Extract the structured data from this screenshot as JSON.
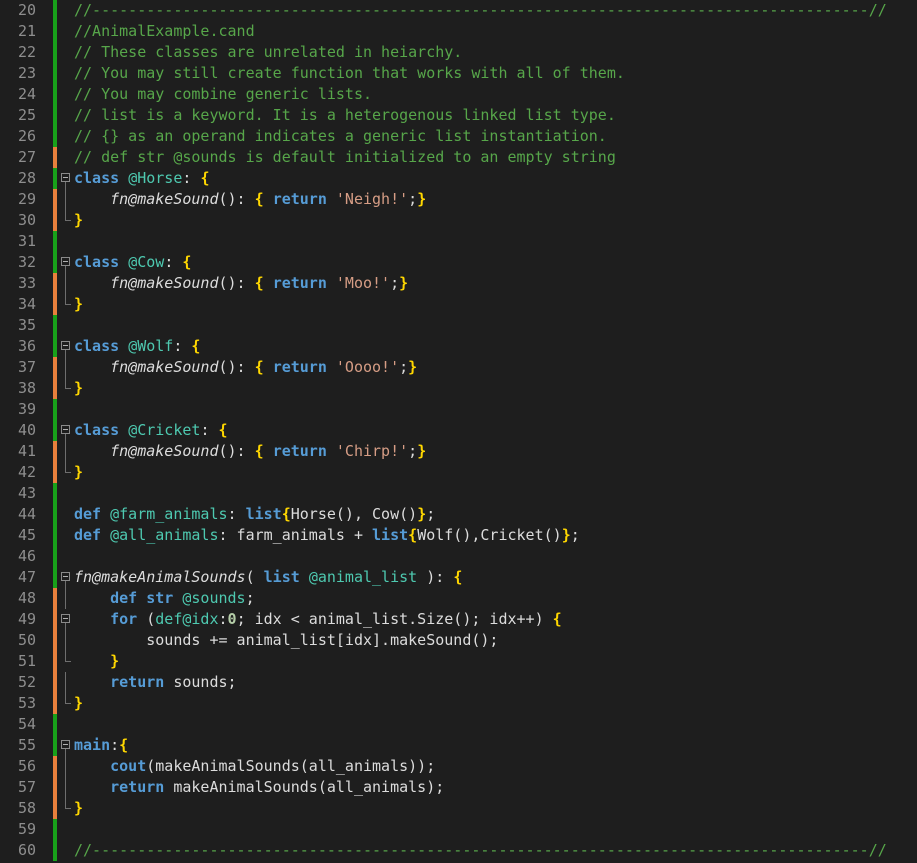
{
  "editor": {
    "colors": {
      "background": "#1e1e1e",
      "line_number": "#8e8e8e",
      "saved_change": "#18a11a",
      "unsaved_change": "#e8803c",
      "comment": "#57a64a",
      "keyword": "#569cd6",
      "identifier": "#4ec9b0",
      "string": "#d69d85",
      "brace": "#ffd700"
    },
    "lines": [
      {
        "n": "20",
        "change": "saved",
        "fold": "none",
        "tokens": [
          [
            "comment",
            "//--------------------------------------------------------------------------------------//"
          ]
        ]
      },
      {
        "n": "21",
        "change": "saved",
        "fold": "none",
        "tokens": [
          [
            "comment",
            "//AnimalExample.cand"
          ]
        ]
      },
      {
        "n": "22",
        "change": "saved",
        "fold": "none",
        "tokens": [
          [
            "comment",
            "// These classes are unrelated in heiarchy."
          ]
        ]
      },
      {
        "n": "23",
        "change": "saved",
        "fold": "none",
        "tokens": [
          [
            "comment",
            "// You may still create function that works with all of them."
          ]
        ]
      },
      {
        "n": "24",
        "change": "saved",
        "fold": "none",
        "tokens": [
          [
            "comment",
            "// You may combine generic lists."
          ]
        ]
      },
      {
        "n": "25",
        "change": "saved",
        "fold": "none",
        "tokens": [
          [
            "comment",
            "// list is a keyword. It is a heterogenous linked list type."
          ]
        ]
      },
      {
        "n": "26",
        "change": "saved",
        "fold": "none",
        "tokens": [
          [
            "comment",
            "// {} as an operand indicates a generic list instantiation."
          ]
        ]
      },
      {
        "n": "27",
        "change": "unsaved",
        "fold": "none",
        "tokens": [
          [
            "comment",
            "// def str @sounds is default initialized to an empty string"
          ]
        ]
      },
      {
        "n": "28",
        "change": "saved",
        "fold": "start",
        "tokens": [
          [
            "kw",
            "class"
          ],
          [
            "p",
            " "
          ],
          [
            "name",
            "@Horse"
          ],
          [
            "p",
            ": "
          ],
          [
            "brace",
            "{"
          ]
        ]
      },
      {
        "n": "29",
        "change": "unsaved",
        "fold": "mid",
        "tokens": [
          [
            "p",
            "    "
          ],
          [
            "fn",
            "fn@makeSound"
          ],
          [
            "p",
            "(): "
          ],
          [
            "brace",
            "{"
          ],
          [
            "p",
            " "
          ],
          [
            "kw",
            "return"
          ],
          [
            "p",
            " "
          ],
          [
            "str",
            "'Neigh!'"
          ],
          [
            "p",
            ";"
          ],
          [
            "brace",
            "}"
          ]
        ]
      },
      {
        "n": "30",
        "change": "unsaved",
        "fold": "end",
        "tokens": [
          [
            "brace",
            "}"
          ]
        ]
      },
      {
        "n": "31",
        "change": "saved",
        "fold": "none",
        "tokens": []
      },
      {
        "n": "32",
        "change": "saved",
        "fold": "start",
        "tokens": [
          [
            "kw",
            "class"
          ],
          [
            "p",
            " "
          ],
          [
            "name",
            "@Cow"
          ],
          [
            "p",
            ": "
          ],
          [
            "brace",
            "{"
          ]
        ]
      },
      {
        "n": "33",
        "change": "unsaved",
        "fold": "mid",
        "tokens": [
          [
            "p",
            "    "
          ],
          [
            "fn",
            "fn@makeSound"
          ],
          [
            "p",
            "(): "
          ],
          [
            "brace",
            "{"
          ],
          [
            "p",
            " "
          ],
          [
            "kw",
            "return"
          ],
          [
            "p",
            " "
          ],
          [
            "str",
            "'Moo!'"
          ],
          [
            "p",
            ";"
          ],
          [
            "brace",
            "}"
          ]
        ]
      },
      {
        "n": "34",
        "change": "unsaved",
        "fold": "end",
        "tokens": [
          [
            "brace",
            "}"
          ]
        ]
      },
      {
        "n": "35",
        "change": "saved",
        "fold": "none",
        "tokens": []
      },
      {
        "n": "36",
        "change": "saved",
        "fold": "start",
        "tokens": [
          [
            "kw",
            "class"
          ],
          [
            "p",
            " "
          ],
          [
            "name",
            "@Wolf"
          ],
          [
            "p",
            ": "
          ],
          [
            "brace",
            "{"
          ]
        ]
      },
      {
        "n": "37",
        "change": "unsaved",
        "fold": "mid",
        "tokens": [
          [
            "p",
            "    "
          ],
          [
            "fn",
            "fn@makeSound"
          ],
          [
            "p",
            "(): "
          ],
          [
            "brace",
            "{"
          ],
          [
            "p",
            " "
          ],
          [
            "kw",
            "return"
          ],
          [
            "p",
            " "
          ],
          [
            "str",
            "'Oooo!'"
          ],
          [
            "p",
            ";"
          ],
          [
            "brace",
            "}"
          ]
        ]
      },
      {
        "n": "38",
        "change": "unsaved",
        "fold": "end",
        "tokens": [
          [
            "brace",
            "}"
          ]
        ]
      },
      {
        "n": "39",
        "change": "saved",
        "fold": "none",
        "tokens": []
      },
      {
        "n": "40",
        "change": "saved",
        "fold": "start",
        "tokens": [
          [
            "kw",
            "class"
          ],
          [
            "p",
            " "
          ],
          [
            "name",
            "@Cricket"
          ],
          [
            "p",
            ": "
          ],
          [
            "brace",
            "{"
          ]
        ]
      },
      {
        "n": "41",
        "change": "unsaved",
        "fold": "mid",
        "tokens": [
          [
            "p",
            "    "
          ],
          [
            "fn",
            "fn@makeSound"
          ],
          [
            "p",
            "(): "
          ],
          [
            "brace",
            "{"
          ],
          [
            "p",
            " "
          ],
          [
            "kw",
            "return"
          ],
          [
            "p",
            " "
          ],
          [
            "str",
            "'Chirp!'"
          ],
          [
            "p",
            ";"
          ],
          [
            "brace",
            "}"
          ]
        ]
      },
      {
        "n": "42",
        "change": "unsaved",
        "fold": "end",
        "tokens": [
          [
            "brace",
            "}"
          ]
        ]
      },
      {
        "n": "43",
        "change": "saved",
        "fold": "none",
        "tokens": []
      },
      {
        "n": "44",
        "change": "saved",
        "fold": "none",
        "tokens": [
          [
            "kw",
            "def"
          ],
          [
            "p",
            " "
          ],
          [
            "name",
            "@farm_animals"
          ],
          [
            "p",
            ": "
          ],
          [
            "kw",
            "list"
          ],
          [
            "brace",
            "{"
          ],
          [
            "p",
            "Horse(), Cow()"
          ],
          [
            "brace",
            "}"
          ],
          [
            "p",
            ";"
          ]
        ]
      },
      {
        "n": "45",
        "change": "saved",
        "fold": "none",
        "tokens": [
          [
            "kw",
            "def"
          ],
          [
            "p",
            " "
          ],
          [
            "name",
            "@all_animals"
          ],
          [
            "p",
            ": farm_animals + "
          ],
          [
            "kw",
            "list"
          ],
          [
            "brace",
            "{"
          ],
          [
            "p",
            "Wolf(),Cricket()"
          ],
          [
            "brace",
            "}"
          ],
          [
            "p",
            ";"
          ]
        ]
      },
      {
        "n": "46",
        "change": "saved",
        "fold": "none",
        "tokens": []
      },
      {
        "n": "47",
        "change": "saved",
        "fold": "start",
        "tokens": [
          [
            "fn",
            "fn@makeAnimalSounds"
          ],
          [
            "p",
            "( "
          ],
          [
            "kw",
            "list"
          ],
          [
            "p",
            " "
          ],
          [
            "name",
            "@animal_list"
          ],
          [
            "p",
            " ): "
          ],
          [
            "brace",
            "{"
          ]
        ]
      },
      {
        "n": "48",
        "change": "unsaved",
        "fold": "mid",
        "tokens": [
          [
            "p",
            "    "
          ],
          [
            "kw",
            "def"
          ],
          [
            "p",
            " "
          ],
          [
            "kw",
            "str"
          ],
          [
            "p",
            " "
          ],
          [
            "name",
            "@sounds"
          ],
          [
            "p",
            ";"
          ]
        ]
      },
      {
        "n": "49",
        "change": "unsaved",
        "fold": "start",
        "tokens": [
          [
            "p",
            "    "
          ],
          [
            "kw",
            "for"
          ],
          [
            "p",
            " ("
          ],
          [
            "name",
            "def@idx"
          ],
          [
            "p",
            ":"
          ],
          [
            "num",
            "0"
          ],
          [
            "p",
            "; idx < animal_list.Size(); idx++) "
          ],
          [
            "brace",
            "{"
          ]
        ]
      },
      {
        "n": "50",
        "change": "unsaved",
        "fold": "mid",
        "tokens": [
          [
            "p",
            "        sounds += animal_list[idx].makeSound();"
          ]
        ]
      },
      {
        "n": "51",
        "change": "unsaved",
        "fold": "end",
        "tokens": [
          [
            "p",
            "    "
          ],
          [
            "brace",
            "}"
          ]
        ]
      },
      {
        "n": "52",
        "change": "unsaved",
        "fold": "mid",
        "tokens": [
          [
            "p",
            "    "
          ],
          [
            "kw",
            "return"
          ],
          [
            "p",
            " sounds;"
          ]
        ]
      },
      {
        "n": "53",
        "change": "unsaved",
        "fold": "end",
        "tokens": [
          [
            "brace",
            "}"
          ]
        ]
      },
      {
        "n": "54",
        "change": "saved",
        "fold": "none",
        "tokens": []
      },
      {
        "n": "55",
        "change": "saved",
        "fold": "start",
        "tokens": [
          [
            "kw",
            "main"
          ],
          [
            "p",
            ":"
          ],
          [
            "brace",
            "{"
          ]
        ]
      },
      {
        "n": "56",
        "change": "unsaved",
        "fold": "mid",
        "tokens": [
          [
            "p",
            "    "
          ],
          [
            "kw",
            "cout"
          ],
          [
            "p",
            "(makeAnimalSounds(all_animals));"
          ]
        ]
      },
      {
        "n": "57",
        "change": "unsaved",
        "fold": "mid",
        "tokens": [
          [
            "p",
            "    "
          ],
          [
            "kw",
            "return"
          ],
          [
            "p",
            " makeAnimalSounds(all_animals);"
          ]
        ]
      },
      {
        "n": "58",
        "change": "unsaved",
        "fold": "end",
        "tokens": [
          [
            "brace",
            "}"
          ]
        ]
      },
      {
        "n": "59",
        "change": "saved",
        "fold": "none",
        "tokens": []
      },
      {
        "n": "60",
        "change": "saved",
        "fold": "none",
        "tokens": [
          [
            "comment",
            "//--------------------------------------------------------------------------------------//"
          ]
        ]
      }
    ]
  }
}
